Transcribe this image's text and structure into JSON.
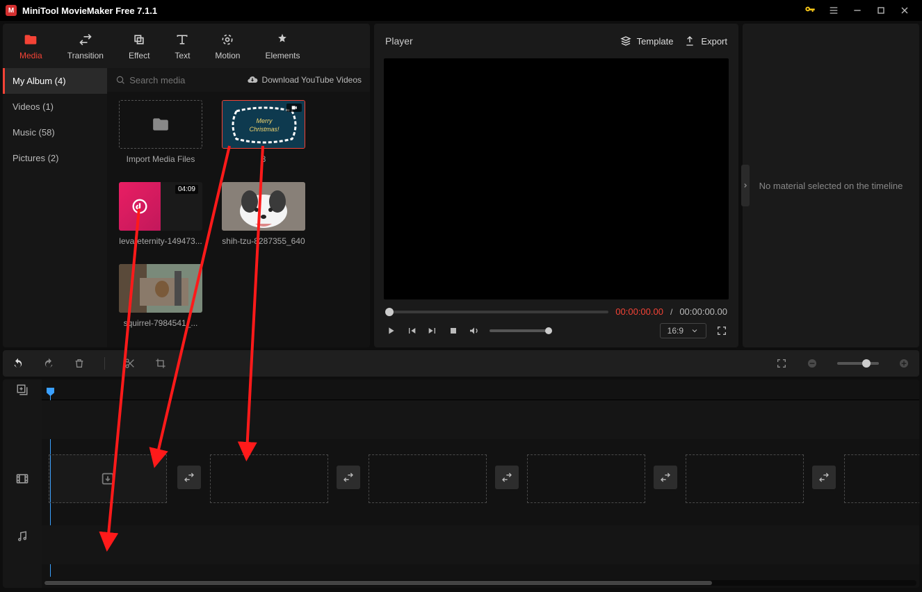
{
  "title": "MiniTool MovieMaker Free 7.1.1",
  "tabs": {
    "media": "Media",
    "transition": "Transition",
    "effect": "Effect",
    "text": "Text",
    "motion": "Motion",
    "elements": "Elements"
  },
  "sidebar": {
    "myalbum": "My Album (4)",
    "videos": "Videos (1)",
    "music": "Music (58)",
    "pictures": "Pictures (2)"
  },
  "media": {
    "searchPlaceholder": "Search media",
    "ytdl": "Download YouTube Videos",
    "import": "Import Media Files",
    "items": [
      {
        "label": "8"
      },
      {
        "label": "leva-eternity-149473...",
        "duration": "04:09"
      },
      {
        "label": "shih-tzu-8287355_640"
      },
      {
        "label": "squirrel-7984541_..."
      }
    ]
  },
  "player": {
    "title": "Player",
    "template": "Template",
    "export": "Export",
    "timeCurrent": "00:00:00.00",
    "timeSep": " / ",
    "timeTotal": "00:00:00.00",
    "aspect": "16:9"
  },
  "props": {
    "empty": "No material selected on the timeline"
  }
}
